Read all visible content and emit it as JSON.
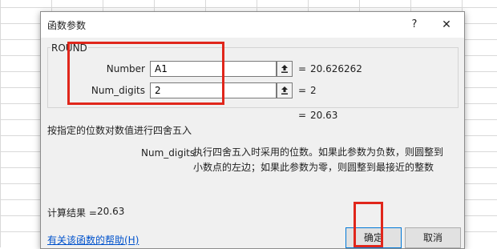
{
  "dialog": {
    "title": "函数参数",
    "help_glyph": "?",
    "close_glyph": "✕",
    "function_name": "ROUND",
    "args": [
      {
        "label": "Number",
        "value": "A1",
        "result": "20.626262"
      },
      {
        "label": "Num_digits",
        "value": "2",
        "result": "2"
      }
    ],
    "equals": "=",
    "function_result": "20.63",
    "description": "按指定的位数对数值进行四舍五入",
    "param_help": {
      "name": "Num_digits",
      "text": "执行四舍五入时采用的位数。如果此参数为负数，则圆整到小数点的左边；如果此参数为零，则圆整到最接近的整数"
    },
    "calc_result_label": "计算结果 =",
    "calc_result_value": "20.63",
    "help_link": "有关该函数的帮助(H)",
    "ok_label": "确定",
    "cancel_label": "取消"
  },
  "colors": {
    "highlight": "#e0261b",
    "link": "#0052cc",
    "dialog_bg": "#f0f0f0"
  },
  "icons": {
    "collapse": "collapse-dialog-icon",
    "close": "close-icon",
    "help": "help-icon"
  }
}
